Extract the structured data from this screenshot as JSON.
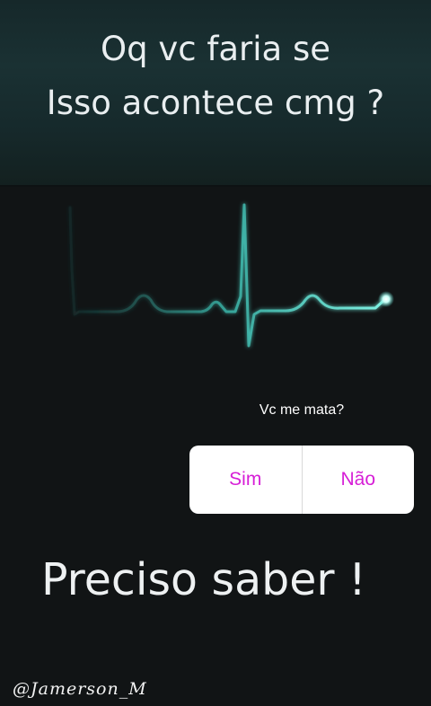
{
  "header": {
    "line1": "Oq vc faria se",
    "line2": "Isso acontece cmg ?"
  },
  "poll": {
    "question": "Vc me mata?",
    "options": [
      "Sim",
      "Não"
    ],
    "option_color": "#d61ed6"
  },
  "caption": "Preciso saber !",
  "signature": "@Jamerson_M",
  "colors": {
    "background": "#111415",
    "header_band": "#1a3133",
    "ecg_line": "#4fd6c8"
  }
}
